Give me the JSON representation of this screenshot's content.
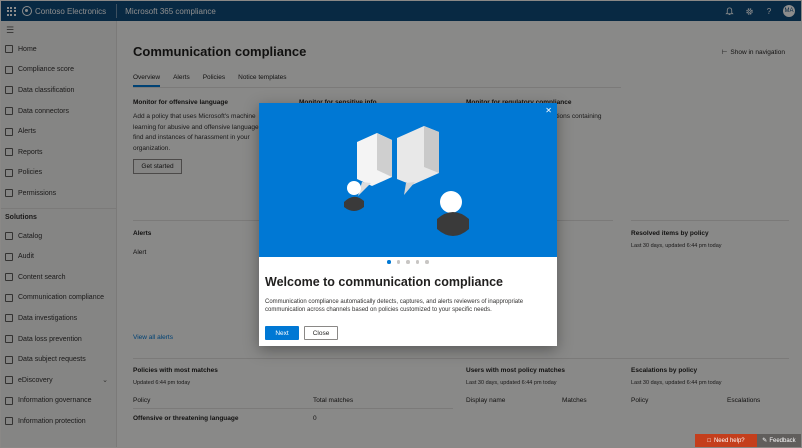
{
  "topbar": {
    "org": "Contoso Electronics",
    "app": "Microsoft 365 compliance",
    "icons": [
      "bell-icon",
      "gear-icon",
      "help-icon",
      "avatar"
    ],
    "help_glyph": "?",
    "avatar_initials": "MA"
  },
  "sidebar": {
    "items": [
      {
        "label": "Home",
        "icon": "home-icon"
      },
      {
        "label": "Compliance score",
        "icon": "score-icon"
      },
      {
        "label": "Data classification",
        "icon": "classification-icon"
      },
      {
        "label": "Data connectors",
        "icon": "connector-icon"
      },
      {
        "label": "Alerts",
        "icon": "alert-icon"
      },
      {
        "label": "Reports",
        "icon": "report-icon"
      },
      {
        "label": "Policies",
        "icon": "policy-icon"
      },
      {
        "label": "Permissions",
        "icon": "key-icon"
      }
    ],
    "section": "Solutions",
    "solutions": [
      {
        "label": "Catalog",
        "icon": "catalog-icon"
      },
      {
        "label": "Audit",
        "icon": "audit-icon"
      },
      {
        "label": "Content search",
        "icon": "search-icon"
      },
      {
        "label": "Communication compliance",
        "icon": "chat-icon"
      },
      {
        "label": "Data investigations",
        "icon": "investigation-icon"
      },
      {
        "label": "Data loss prevention",
        "icon": "shield-icon"
      },
      {
        "label": "Data subject requests",
        "icon": "person-icon"
      },
      {
        "label": "eDiscovery",
        "icon": "ediscovery-icon"
      },
      {
        "label": "Information governance",
        "icon": "governance-icon"
      },
      {
        "label": "Information protection",
        "icon": "lock-icon"
      }
    ]
  },
  "main": {
    "title": "Communication compliance",
    "show_nav": "Show in navigation",
    "tabs": [
      "Overview",
      "Alerts",
      "Policies",
      "Notice templates"
    ],
    "cards": [
      {
        "title": "Monitor for offensive language",
        "desc": "Add a policy that uses Microsoft's machine learning for abusive and offensive language to find and instances of harassment in your organization."
      },
      {
        "title": "Monitor for sensitive info"
      },
      {
        "title": "Monitor for regulatory compliance",
        "desc": "ications containing"
      }
    ],
    "get_started": "Get started",
    "alerts_title": "Alerts",
    "alert_col": "Alert",
    "view_all_alerts": "View all alerts",
    "resolved": {
      "title": "Resolved items by policy",
      "updated": "Last 30 days, updated 6:44 pm today"
    },
    "policies_matches": {
      "title": "Policies with most matches",
      "updated": "Updated 6:44 pm today",
      "cols": [
        "Policy",
        "Total matches"
      ],
      "rows": [
        {
          "policy": "Offensive or threatening language",
          "matches": "0"
        }
      ]
    },
    "users_matches": {
      "title": "Users with most policy matches",
      "updated": "Last 30 days, updated 6:44 pm today",
      "cols": [
        "Display name",
        "Matches"
      ]
    },
    "escalations": {
      "title": "Escalations by policy",
      "updated": "Last 30 days, updated 6:44 pm today",
      "cols": [
        "Policy",
        "Escalations"
      ]
    }
  },
  "modal": {
    "title": "Welcome to communication compliance",
    "body": "Communication compliance automatically detects, captures, and alerts reviewers of inappropriate communication across channels based on policies customized to your specific needs.",
    "next": "Next",
    "close": "Close",
    "pages": 5,
    "current_page": 1,
    "hero_color": "#0078d4"
  },
  "footer": {
    "help": "Need help?",
    "feedback": "Feedback"
  }
}
